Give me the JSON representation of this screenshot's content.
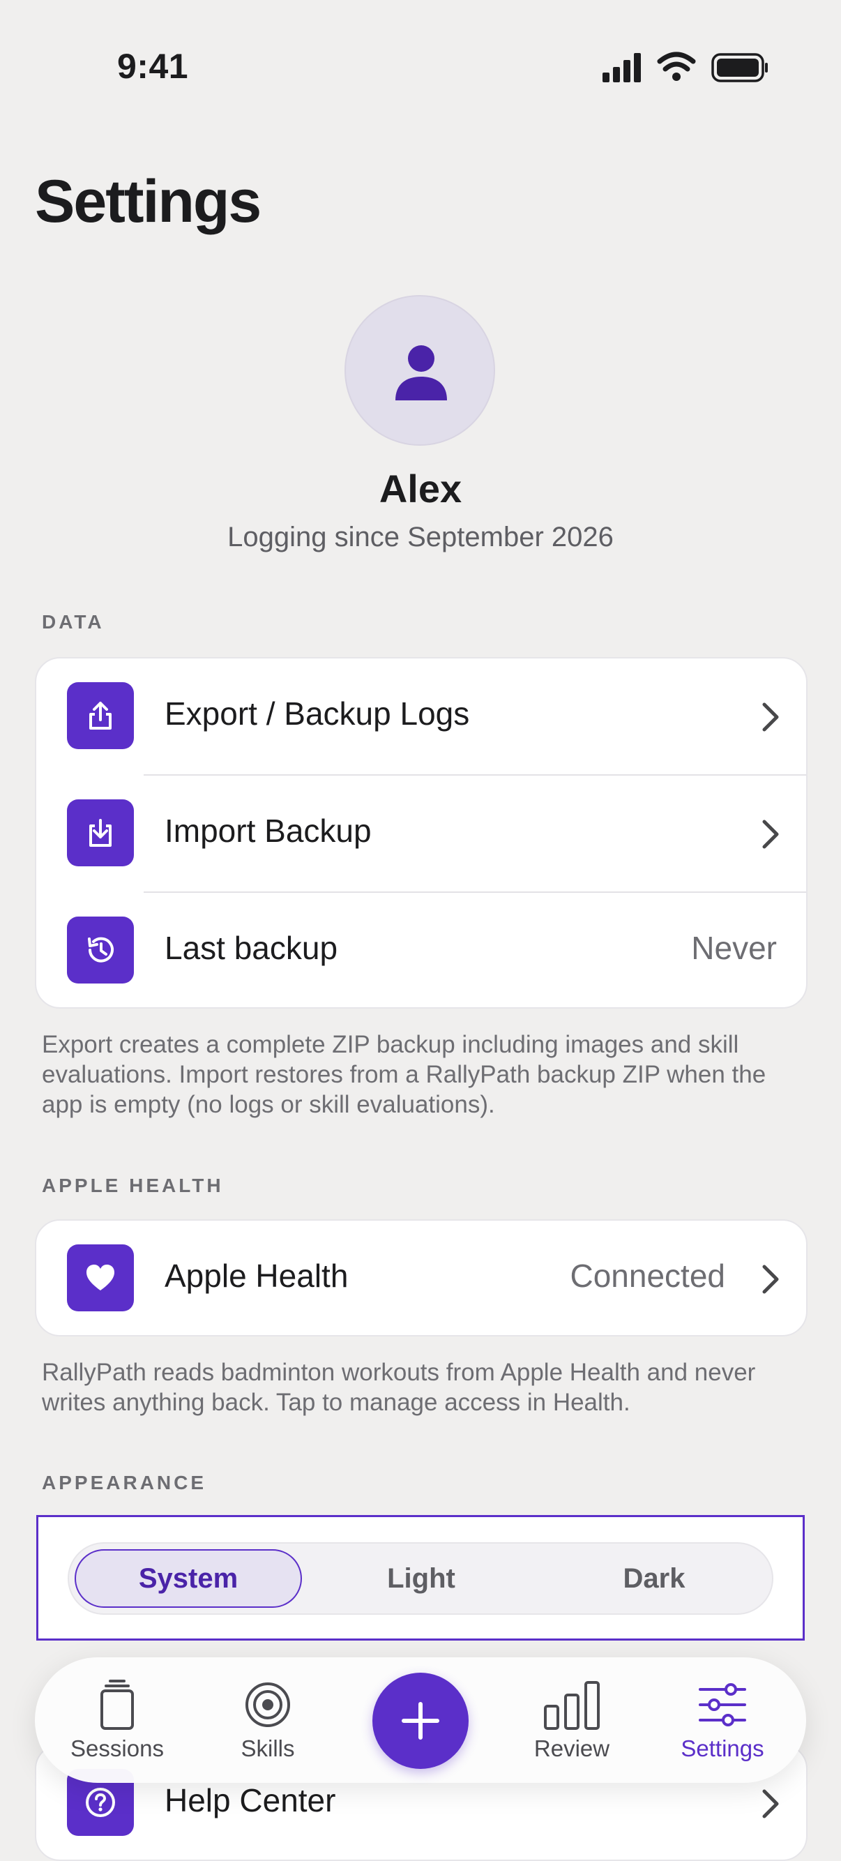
{
  "status_bar": {
    "time": "9:41"
  },
  "page": {
    "title": "Settings"
  },
  "profile": {
    "name": "Alex",
    "subtitle": "Logging since September 2026"
  },
  "data_section": {
    "header": "DATA",
    "rows": [
      {
        "label": "Export / Backup Logs",
        "icon": "export-icon"
      },
      {
        "label": "Import Backup",
        "icon": "import-icon"
      },
      {
        "label": "Last backup",
        "value": "Never",
        "icon": "history-icon"
      }
    ],
    "footnote": "Export creates a complete ZIP backup including images and skill evaluations. Import restores from a RallyPath backup ZIP when the app is empty (no logs or skill evaluations)."
  },
  "health_section": {
    "header": "APPLE HEALTH",
    "row": {
      "label": "Apple Health",
      "value": "Connected",
      "icon": "heart-icon"
    },
    "footnote": "RallyPath reads badminton workouts from Apple Health and never writes anything back. Tap to manage access in Health."
  },
  "appearance_section": {
    "header": "APPEARANCE",
    "options": [
      "System",
      "Light",
      "Dark"
    ],
    "selected": "System"
  },
  "help_row": {
    "label": "Help Center",
    "icon": "question-icon"
  },
  "tab_bar": {
    "tabs": [
      {
        "label": "Sessions",
        "icon": "sessions-icon"
      },
      {
        "label": "Skills",
        "icon": "target-icon"
      },
      {
        "label": "Review",
        "icon": "bar-chart-icon"
      },
      {
        "label": "Settings",
        "icon": "sliders-icon"
      }
    ],
    "active": "Settings",
    "add_icon": "plus-icon"
  },
  "colors": {
    "accent": "#5B2FC9",
    "background": "#F0EFEE",
    "card": "#FFFFFF"
  }
}
